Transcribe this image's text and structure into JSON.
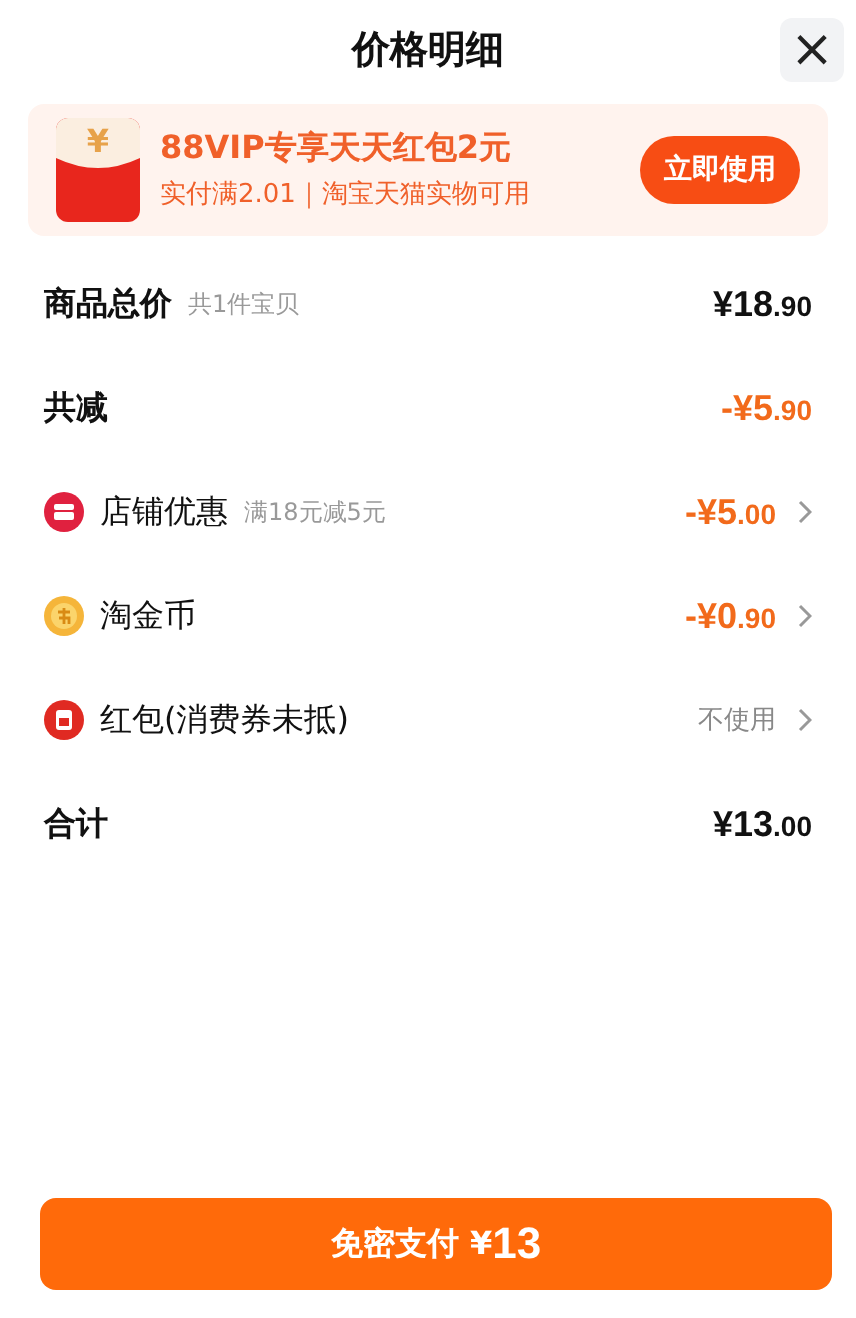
{
  "header": {
    "title": "价格明细",
    "close": "×"
  },
  "promo": {
    "title": "88VIP专享天天红包2元",
    "subtitle": "实付满2.01｜淘宝天猫实物可用",
    "icon_glyph": "¥",
    "button": "立即使用"
  },
  "rows": [
    {
      "kind": "total",
      "label": "商品总价",
      "note": "共1件宝贝",
      "main": "¥18",
      "cents": ".90"
    },
    {
      "kind": "reduction",
      "label": "共减",
      "main": "-¥5",
      "cents": ".90"
    },
    {
      "kind": "shop",
      "label": "店铺优惠",
      "note": "满18元减5元",
      "main": "-¥5",
      "cents": ".00"
    },
    {
      "kind": "coin",
      "label": "淘金币",
      "main": "-¥0",
      "cents": ".90"
    },
    {
      "kind": "envelope",
      "label": "红包(消费券未抵)",
      "value": "不使用"
    },
    {
      "kind": "total",
      "label": "合计",
      "main": "¥13",
      "cents": ".00"
    }
  ],
  "pay_button": {
    "label": "免密支付",
    "currency": "¥",
    "amount": "13"
  }
}
